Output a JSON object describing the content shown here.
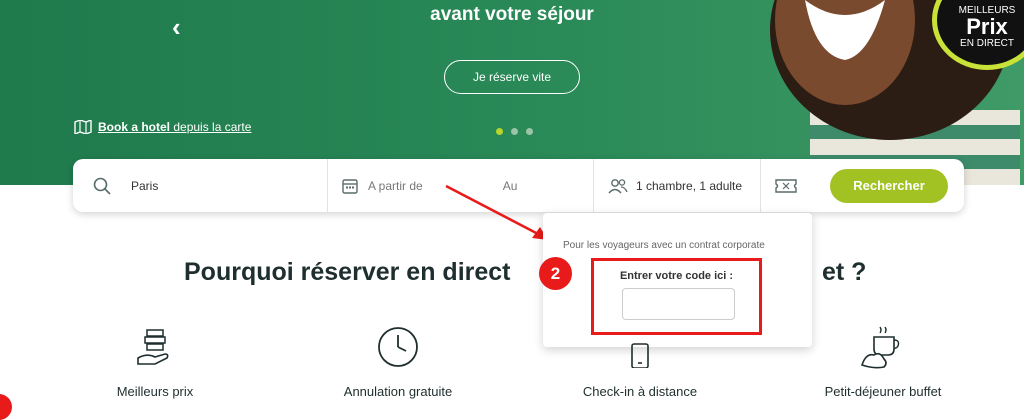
{
  "hero": {
    "title": "avant votre séjour",
    "cta_label": "Je réserve vite",
    "map_link": {
      "bold": "Book a hotel",
      "rest": " depuis la carte"
    },
    "badge": {
      "top": "MEILLEURS",
      "main": "Prix",
      "bottom": "EN DIRECT"
    }
  },
  "search": {
    "destination_value": "Paris",
    "date_from_placeholder": "A partir de",
    "date_to_placeholder": "Au",
    "guests_value": "1 chambre, 1 adulte",
    "submit_label": "Rechercher"
  },
  "corporate": {
    "description": "Pour les voyageurs avec un contrat corporate",
    "label": "Entrer votre code ici :",
    "step_number": "2"
  },
  "section": {
    "title_left": "Pourquoi réserver en direct",
    "title_right": "et ?"
  },
  "features": [
    {
      "label": "Meilleurs prix",
      "icon": "money-hand-icon"
    },
    {
      "label": "Annulation gratuite",
      "icon": "clock-icon"
    },
    {
      "label": "Check-in à distance",
      "icon": "phone-icon"
    },
    {
      "label": "Petit-déjeuner buffet",
      "icon": "coffee-croissant-icon"
    }
  ],
  "colors": {
    "brand_green": "#2a8a58",
    "accent_lime": "#a2c224",
    "annotation_red": "#e81a1a"
  }
}
